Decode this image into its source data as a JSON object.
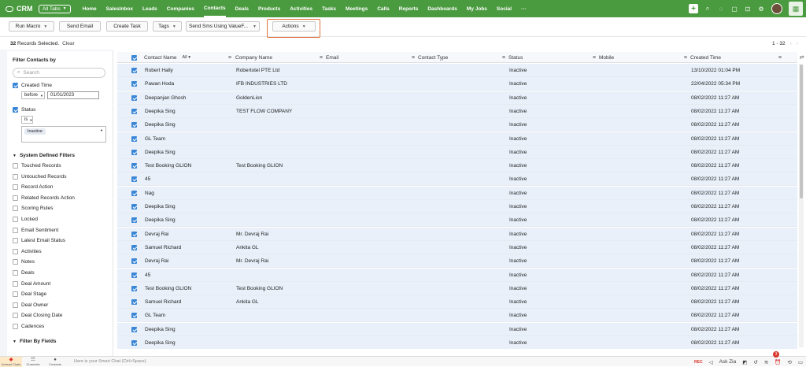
{
  "topnav": {
    "brand": "CRM",
    "all_tabs": "All Tabs",
    "tabs": [
      "Home",
      "SalesInbox",
      "Leads",
      "Companies",
      "Contacts",
      "Deals",
      "Products",
      "Activities",
      "Tasks",
      "Meetings",
      "Calls",
      "Reports",
      "Dashboards",
      "My Jobs",
      "Social",
      "···"
    ],
    "active_tab": "Contacts"
  },
  "toolbar": {
    "run_macro": "Run Macro",
    "send_email": "Send Email",
    "create_task": "Create Task",
    "tags": "Tags",
    "send_sms": "Send Sms Using ValueF...",
    "actions": "Actions"
  },
  "selection": {
    "count": "32",
    "label": "Records Selected.",
    "clear": "Clear",
    "range": "1 - 32"
  },
  "sidebar": {
    "title": "Filter Contacts by",
    "search_placeholder": "Search",
    "created_time": {
      "label": "Created Time",
      "operator": "before",
      "value": "01/01/2023"
    },
    "status": {
      "label": "Status",
      "operator": "is",
      "value": "Inactive"
    },
    "system_section": "System Defined Filters",
    "system_filters": [
      "Touched Records",
      "Untouched Records",
      "Record Action",
      "Related Records Action",
      "Scoring Rules",
      "Locked",
      "Email Sentiment",
      "Latest Email Status",
      "Activities",
      "Notes",
      "Deals",
      "Deal Amount",
      "Deal Stage",
      "Deal Owner",
      "Deal Closing Date",
      "Cadences"
    ],
    "fields_section": "Filter By Fields"
  },
  "table": {
    "all_badge": "All",
    "columns": [
      "Contact Name",
      "Company Name",
      "Email",
      "Contact Type",
      "Status",
      "Mobile",
      "Created Time"
    ],
    "rows": [
      [
        "Robert Hally",
        "Robertotel PTE Ltd",
        "",
        "",
        "Inactive",
        "",
        "13/10/2022 01:04 PM"
      ],
      [
        "Pawan Hoda",
        "IFB INDUSTRIES LTD",
        "",
        "",
        "Inactive",
        "",
        "22/04/2022 05:34 PM"
      ],
      [
        "Deepanjan Ghosh",
        "GoldenLion",
        "",
        "",
        "Inactive",
        "",
        "08/02/2022 11:27 AM"
      ],
      [
        "Deepika Sing",
        "TEST FLOW COMPANY",
        "",
        "",
        "Inactive",
        "",
        "08/02/2022 11:27 AM"
      ],
      [
        "Deepika Sing",
        "",
        "",
        "",
        "Inactive",
        "",
        "08/02/2022 11:27 AM"
      ],
      [
        "GL Team",
        "",
        "",
        "",
        "Inactive",
        "",
        "08/02/2022 11:27 AM"
      ],
      [
        "Deepika Sing",
        "",
        "",
        "",
        "Inactive",
        "",
        "08/02/2022 11:27 AM"
      ],
      [
        "Test Booking GLION",
        "Test Booking GLION",
        "",
        "",
        "Inactive",
        "",
        "08/02/2022 11:27 AM"
      ],
      [
        "45",
        "",
        "",
        "",
        "Inactive",
        "",
        "08/02/2022 11:27 AM"
      ],
      [
        "Nag",
        "",
        "",
        "",
        "Inactive",
        "",
        "08/02/2022 11:27 AM"
      ],
      [
        "Deepika Sing",
        "",
        "",
        "",
        "Inactive",
        "",
        "08/02/2022 11:27 AM"
      ],
      [
        "Deepika Sing",
        "",
        "",
        "",
        "Inactive",
        "",
        "08/02/2022 11:27 AM"
      ],
      [
        "Devraj Rai",
        "Mr. Devraj Rai",
        "",
        "",
        "Inactive",
        "",
        "08/02/2022 11:27 AM"
      ],
      [
        "Samuel Richard",
        "Ankita GL",
        "",
        "",
        "Inactive",
        "",
        "08/02/2022 11:27 AM"
      ],
      [
        "Devraj Rai",
        "Mr. Devraj Rai",
        "",
        "",
        "Inactive",
        "",
        "08/02/2022 11:27 AM"
      ],
      [
        "45",
        "",
        "",
        "",
        "Inactive",
        "",
        "08/02/2022 11:27 AM"
      ],
      [
        "Test Booking GLION",
        "Test Booking GLION",
        "",
        "",
        "Inactive",
        "",
        "08/02/2022 11:27 AM"
      ],
      [
        "Samuel Richard",
        "Ankita GL",
        "",
        "",
        "Inactive",
        "",
        "08/02/2022 11:27 AM"
      ],
      [
        "GL Team",
        "",
        "",
        "",
        "Inactive",
        "",
        "08/02/2022 11:27 AM"
      ],
      [
        "Deepika Sing",
        "",
        "",
        "",
        "Inactive",
        "",
        "08/02/2022 11:27 AM"
      ],
      [
        "Deepika Sing",
        "",
        "",
        "",
        "Inactive",
        "",
        "08/02/2022 11:27 AM"
      ]
    ]
  },
  "bottombar": {
    "unread_chats": "Unread Chats",
    "channels": "Channels",
    "contacts": "Contacts",
    "smart_chat": "Here is your Smart Chat (Ctrl+Space)",
    "ask_zia": "Ask Zia",
    "notif_count": "3"
  },
  "colors": {
    "nav_green": "#4a9a3f",
    "highlight": "#e0733d",
    "checkbox_blue": "#3a87d6",
    "row_selected": "#e9f0fa"
  }
}
